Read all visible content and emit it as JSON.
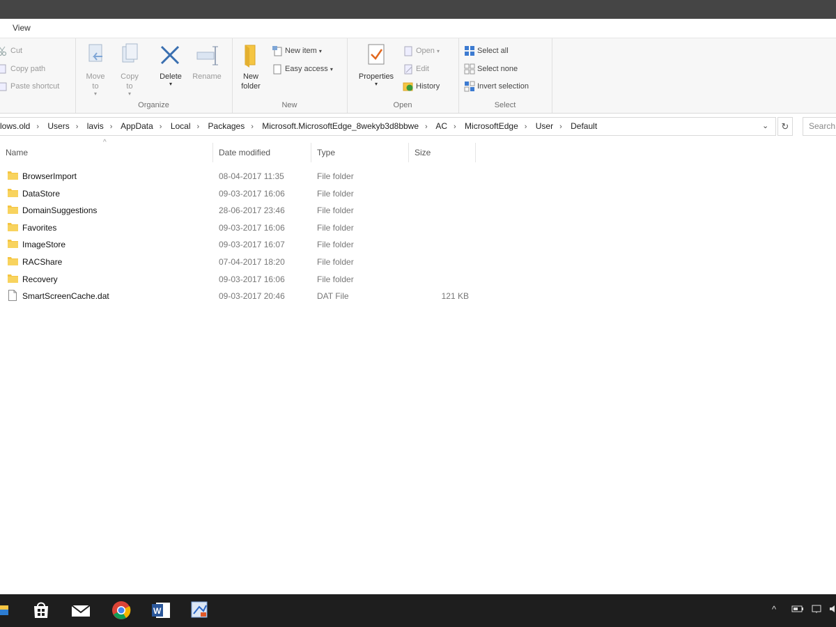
{
  "menu": {
    "view_tab": "View"
  },
  "ribbon": {
    "clipboard": {
      "cut": "Cut",
      "copy_path": "Copy path",
      "paste_shortcut": "Paste shortcut"
    },
    "organize": {
      "label": "Organize",
      "move_to_line1": "Move",
      "move_to_line2": "to",
      "copy_to_line1": "Copy",
      "copy_to_line2": "to",
      "delete": "Delete",
      "rename": "Rename"
    },
    "new": {
      "label": "New",
      "new_folder_line1": "New",
      "new_folder_line2": "folder",
      "new_item": "New item",
      "easy_access": "Easy access"
    },
    "open": {
      "label": "Open",
      "properties": "Properties",
      "open": "Open",
      "edit": "Edit",
      "history": "History"
    },
    "select": {
      "label": "Select",
      "select_all": "Select all",
      "select_none": "Select none",
      "invert_selection": "Invert selection"
    }
  },
  "address": {
    "crumbs": [
      "lows.old",
      "Users",
      "lavis",
      "AppData",
      "Local",
      "Packages",
      "Microsoft.MicrosoftEdge_8wekyb3d8bbwe",
      "AC",
      "MicrosoftEdge",
      "User",
      "Default"
    ],
    "search_placeholder": "Search"
  },
  "columns": {
    "name": "Name",
    "date": "Date modified",
    "type": "Type",
    "size": "Size"
  },
  "files": [
    {
      "name": "BrowserImport",
      "date": "08-04-2017 11:35",
      "type": "File folder",
      "size": "",
      "kind": "folder"
    },
    {
      "name": "DataStore",
      "date": "09-03-2017 16:06",
      "type": "File folder",
      "size": "",
      "kind": "folder"
    },
    {
      "name": "DomainSuggestions",
      "date": "28-06-2017 23:46",
      "type": "File folder",
      "size": "",
      "kind": "folder"
    },
    {
      "name": "Favorites",
      "date": "09-03-2017 16:06",
      "type": "File folder",
      "size": "",
      "kind": "folder"
    },
    {
      "name": "ImageStore",
      "date": "09-03-2017 16:07",
      "type": "File folder",
      "size": "",
      "kind": "folder"
    },
    {
      "name": "RACShare",
      "date": "07-04-2017 18:20",
      "type": "File folder",
      "size": "",
      "kind": "folder"
    },
    {
      "name": "Recovery",
      "date": "09-03-2017 16:06",
      "type": "File folder",
      "size": "",
      "kind": "folder"
    },
    {
      "name": "SmartScreenCache.dat",
      "date": "09-03-2017 20:46",
      "type": "DAT File",
      "size": "121 KB",
      "kind": "file"
    }
  ],
  "taskbar": {
    "icons": [
      "file-explorer-icon",
      "store-icon",
      "mail-icon",
      "chrome-icon",
      "word-icon",
      "paint-icon"
    ]
  },
  "colors": {
    "folder": "#f5c542",
    "accent": "#1e78d2",
    "taskbar": "#1e1e1e"
  }
}
